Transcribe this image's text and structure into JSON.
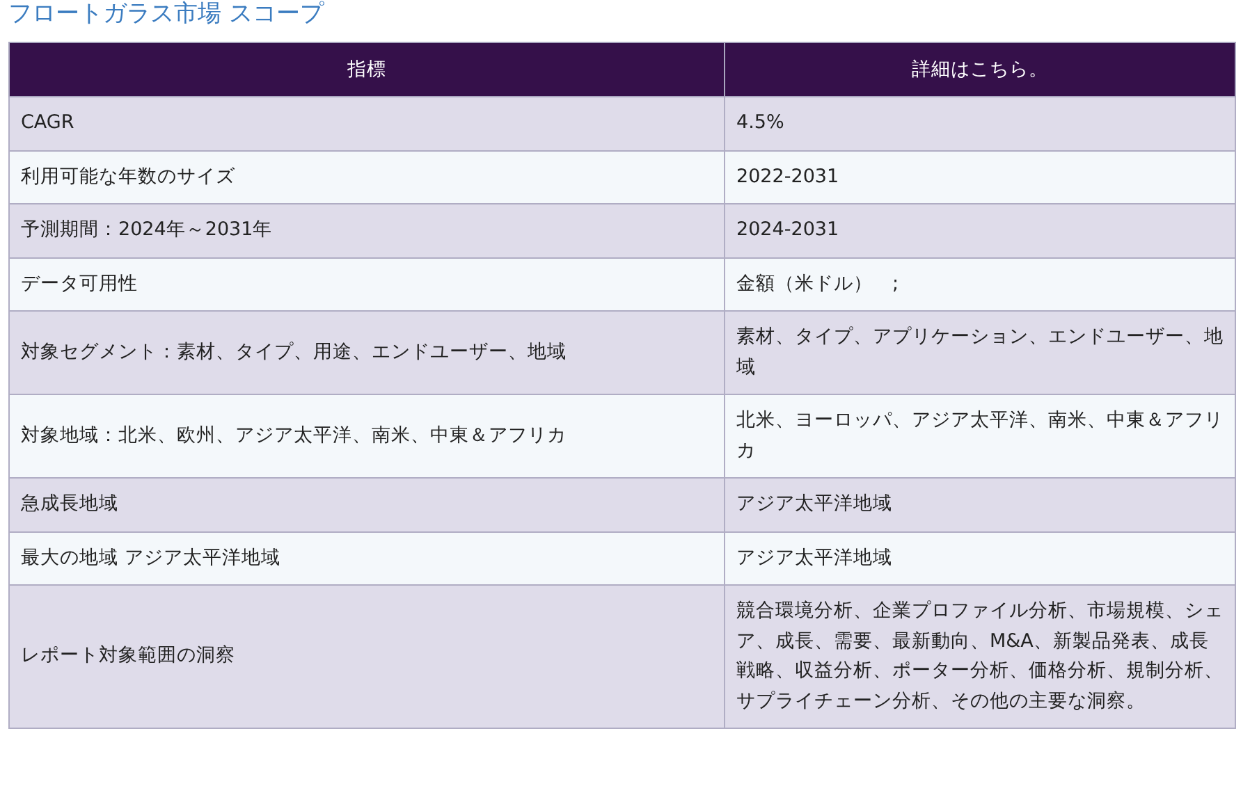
{
  "title": "フロートガラス市場 スコープ",
  "table": {
    "columns": [
      "指標",
      "詳細はこちら。"
    ],
    "rows": [
      [
        "CAGR",
        "4.5%"
      ],
      [
        "利用可能な年数のサイズ",
        "2022-2031"
      ],
      [
        "予測期間：2024年～2031年",
        "2024-2031"
      ],
      [
        "データ可用性",
        "金額（米ドル）　;"
      ],
      [
        "対象セグメント：素材、タイプ、用途、エンドユーザー、地域",
        "素材、タイプ、アプリケーション、エンドユーザー、地域"
      ],
      [
        "対象地域：北米、欧州、アジア太平洋、南米、中東＆アフリカ",
        "北米、ヨーロッパ、アジア太平洋、南米、中東＆アフリカ"
      ],
      [
        "急成長地域",
        "アジア太平洋地域"
      ],
      [
        "最大の地域 アジア太平洋地域",
        "アジア太平洋地域"
      ],
      [
        "レポート対象範囲の洞察",
        "競合環境分析、企業プロファイル分析、市場規模、シェア、成長、需要、最新動向、M&A、新製品発表、成長戦略、収益分析、ポーター分析、価格分析、規制分析、サプライチェーン分析、その他の主要な洞察。"
      ]
    ]
  }
}
